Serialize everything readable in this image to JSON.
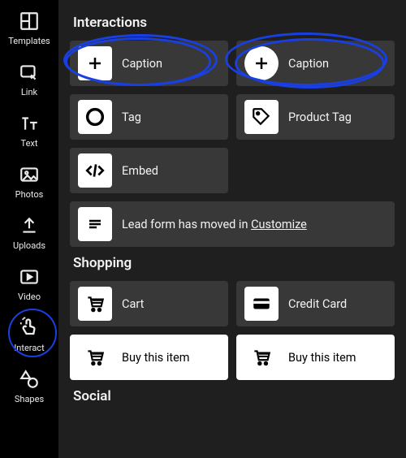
{
  "sidebar": {
    "items": [
      {
        "label": "Templates",
        "icon": "templates-icon"
      },
      {
        "label": "Link",
        "icon": "link-cursor-icon"
      },
      {
        "label": "Text",
        "icon": "text-icon"
      },
      {
        "label": "Photos",
        "icon": "image-icon"
      },
      {
        "label": "Uploads",
        "icon": "upload-icon"
      },
      {
        "label": "Video",
        "icon": "video-icon"
      },
      {
        "label": "Interact",
        "icon": "interact-icon"
      },
      {
        "label": "Shapes",
        "icon": "shapes-icon"
      }
    ],
    "selected_index": 6
  },
  "interactions": {
    "title": "Interactions",
    "items": [
      {
        "label": "Caption",
        "icon": "plus-icon",
        "thumb": "white",
        "highlighted": true
      },
      {
        "label": "Caption",
        "icon": "plus-icon",
        "thumb": "circle",
        "highlighted": true
      },
      {
        "label": "Tag",
        "icon": "ring-icon",
        "thumb": "white"
      },
      {
        "label": "Product Tag",
        "icon": "tag-icon",
        "thumb": "white"
      },
      {
        "label": "Embed",
        "icon": "embed-icon",
        "thumb": "white"
      }
    ],
    "notice": {
      "prefix": "Lead form has moved in ",
      "link": "Customize",
      "icon": "lines-icon"
    }
  },
  "shopping": {
    "title": "Shopping",
    "items": [
      {
        "label": "Cart",
        "icon": "cart-icon",
        "thumb": "white"
      },
      {
        "label": "Credit Card",
        "icon": "card-icon",
        "thumb": "white"
      },
      {
        "label": "Buy this item",
        "icon": "cart-icon",
        "bg": "white"
      },
      {
        "label": "Buy this item",
        "icon": "cart-icon",
        "bg": "white"
      }
    ]
  },
  "social": {
    "title": "Social"
  }
}
